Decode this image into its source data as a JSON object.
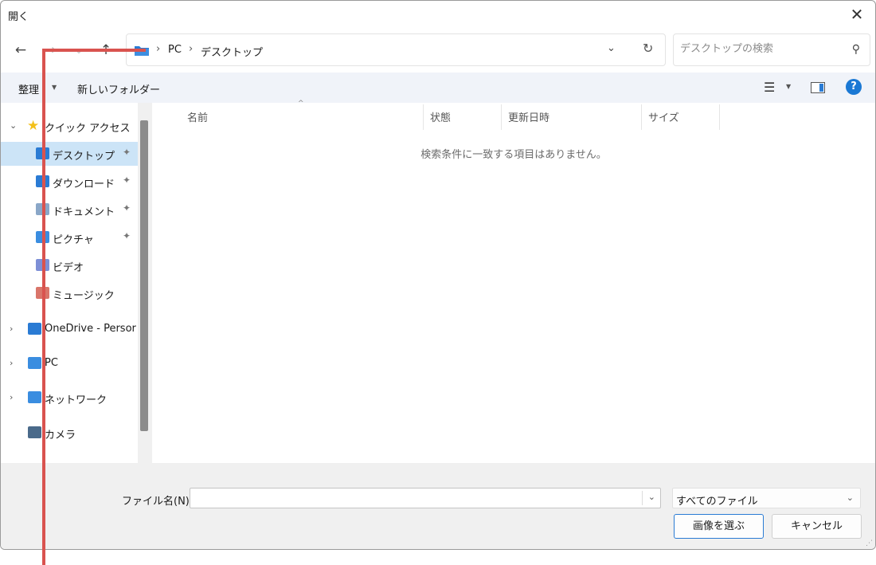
{
  "window": {
    "title": "開く",
    "close_glyph": "✕"
  },
  "nav_buttons": {
    "back": "←",
    "forward": "→",
    "recent": "⌄",
    "up": "↑"
  },
  "address": {
    "crumb_sep": "›",
    "crumbs": [
      "PC",
      "デスクトップ"
    ],
    "dropdown_glyph": "⌄",
    "refresh_glyph": "↻"
  },
  "search": {
    "placeholder": "デスクトップの検索",
    "icon_glyph": "⚲"
  },
  "toolbar": {
    "organize_label": "整理",
    "new_folder_label": "新しいフォルダー",
    "view_glyph": "☰",
    "help_glyph": "?"
  },
  "sidebar": {
    "items": [
      {
        "label": "クイック アクセス",
        "chevron": "⌄",
        "icon": "star-icon"
      },
      {
        "label": "デスクトップ",
        "pinned": true,
        "icon": "desktop-icon",
        "selected": true
      },
      {
        "label": "ダウンロード",
        "pinned": true,
        "icon": "downloads-icon"
      },
      {
        "label": "ドキュメント",
        "pinned": true,
        "icon": "documents-icon"
      },
      {
        "label": "ピクチャ",
        "pinned": true,
        "icon": "pictures-icon"
      },
      {
        "label": "ビデオ",
        "icon": "videos-icon"
      },
      {
        "label": "ミュージック",
        "icon": "music-icon"
      },
      {
        "label": "OneDrive - Persor",
        "chevron": "›",
        "icon": "onedrive-icon"
      },
      {
        "label": "PC",
        "chevron": "›",
        "icon": "pc-icon"
      },
      {
        "label": "ネットワーク",
        "chevron": "›",
        "icon": "network-icon"
      },
      {
        "label": "カメラ",
        "icon": "camera-icon"
      }
    ],
    "pin_glyph": "📌"
  },
  "content": {
    "columns": [
      "名前",
      "状態",
      "更新日時",
      "サイズ"
    ],
    "sort_caret": "^",
    "empty_message": "検索条件に一致する項目はありません。"
  },
  "footer": {
    "filename_label": "ファイル名(N):",
    "filename_value": "",
    "filename_dropdown": "⌄",
    "filetype_value": "すべてのファイル",
    "filetype_dropdown": "⌄",
    "primary_button": "画像を選ぶ",
    "cancel_button": "キャンセル"
  },
  "colors": {
    "accent": "#1a78d4",
    "selected_bg": "#cce4f7",
    "annotation": "#d9534f"
  }
}
